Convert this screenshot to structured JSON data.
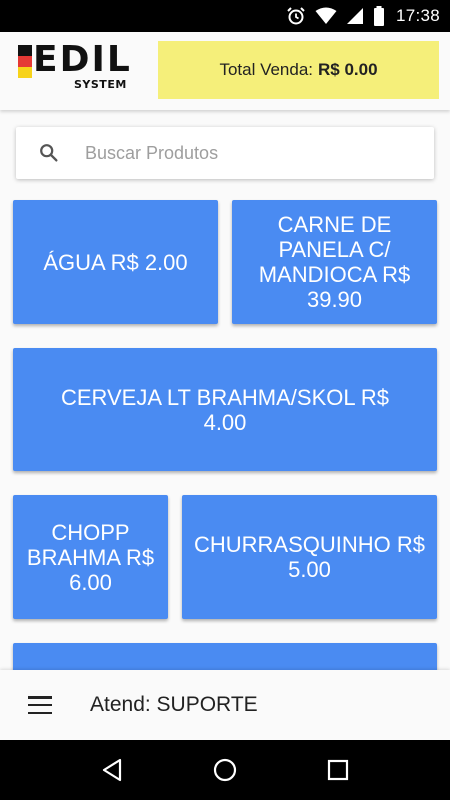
{
  "status_bar": {
    "time": "17:38",
    "icons": [
      "alarm-icon",
      "wifi-icon",
      "signal-icon",
      "battery-icon"
    ]
  },
  "header": {
    "logo_text": "EDIL",
    "logo_subtext": "SYSTEM",
    "total_label": "Total Venda:",
    "total_value": "R$ 0.00"
  },
  "search": {
    "placeholder": "Buscar Produtos",
    "value": ""
  },
  "products": [
    {
      "label": "ÁGUA R$ 2.00"
    },
    {
      "label": "CARNE DE PANELA C/ MANDIOCA R$ 39.90"
    },
    {
      "label": "CERVEJA LT BRAHMA/SKOL R$ 4.00"
    },
    {
      "label": "CHOPP BRAHMA R$ 6.00"
    },
    {
      "label": "CHURRASQUINHO R$ 5.00"
    },
    {
      "label": ""
    }
  ],
  "footer": {
    "attendant_text": "Atend: SUPORTE"
  },
  "colors": {
    "product_button": "#4a8bf2",
    "total_box": "#f5ef7a",
    "logo_stripes": [
      "#111111",
      "#e53935",
      "#f7d31a"
    ]
  }
}
